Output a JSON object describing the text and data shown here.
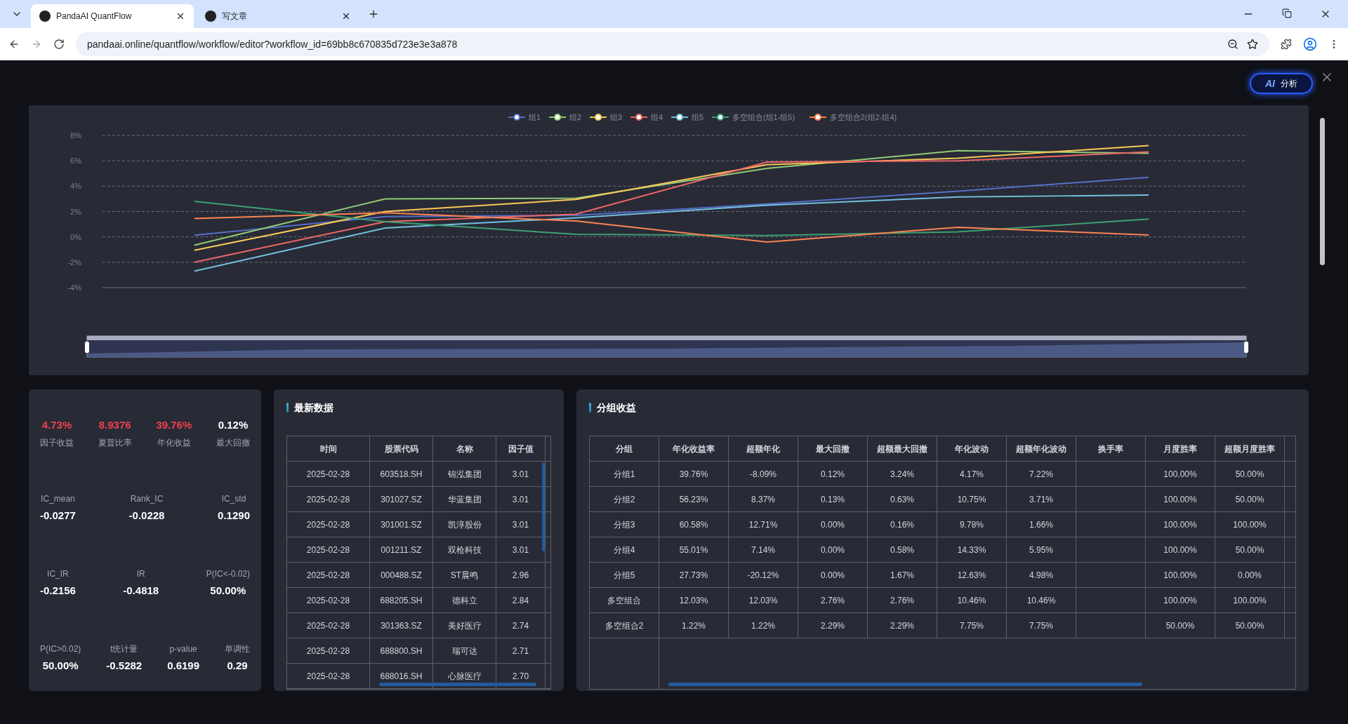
{
  "browser": {
    "tabs": [
      {
        "title": "PandaAI QuantFlow",
        "selected": true
      },
      {
        "title": "写文章",
        "selected": false
      }
    ],
    "url": "pandaai.online/quantflow/workflow/editor?workflow_id=69bb8c670835d723e3e3a878"
  },
  "ai_button": {
    "label": "分析",
    "logo": "AI"
  },
  "chart": {
    "chart_data": {
      "type": "line",
      "legend": "top",
      "grid": true,
      "yticks": [
        {
          "value": 8,
          "label": "8%"
        },
        {
          "value": 6,
          "label": "6%"
        },
        {
          "value": 4,
          "label": "4%"
        },
        {
          "value": 2,
          "label": "2%"
        },
        {
          "value": 0,
          "label": "0%"
        },
        {
          "value": -2,
          "label": "-2%"
        },
        {
          "value": -4,
          "label": "-4%"
        }
      ],
      "ylim": [
        -4,
        8
      ],
      "series": [
        {
          "name": "组1",
          "color": "#5470c6",
          "values": [
            0.13,
            1.6,
            1.7,
            2.6,
            3.6,
            4.7
          ]
        },
        {
          "name": "组2",
          "color": "#91cc75",
          "values": [
            -0.65,
            3.0,
            3.05,
            5.4,
            6.8,
            6.6
          ]
        },
        {
          "name": "组3",
          "color": "#fac858",
          "values": [
            -1.05,
            2.0,
            2.95,
            5.7,
            6.2,
            7.2
          ]
        },
        {
          "name": "组4",
          "color": "#ee6666",
          "values": [
            -2.0,
            1.2,
            1.8,
            5.9,
            6.0,
            6.7
          ]
        },
        {
          "name": "组5",
          "color": "#73c0de",
          "values": [
            -2.7,
            0.7,
            1.5,
            2.5,
            3.15,
            3.3
          ]
        },
        {
          "name": "多空组合(组1-组5)",
          "color": "#3ba272",
          "values": [
            2.8,
            1.2,
            0.2,
            0.1,
            0.4,
            1.4
          ]
        },
        {
          "name": "多空组合2(组2-组4)",
          "color": "#fc8452",
          "values": [
            1.45,
            1.9,
            1.25,
            -0.4,
            0.75,
            0.15
          ]
        }
      ]
    }
  },
  "metrics": {
    "top": [
      {
        "value": "4.73%",
        "label": "因子收益",
        "color": "#f0424f"
      },
      {
        "value": "8.9376",
        "label": "夏普比率",
        "color": "#f0424f"
      },
      {
        "value": "39.76%",
        "label": "年化收益",
        "color": "#f0424f"
      },
      {
        "value": "0.12%",
        "label": "最大回撤",
        "color": "#ffffff"
      }
    ],
    "rows": [
      [
        {
          "label": "IC_mean",
          "value": "-0.0277"
        },
        {
          "label": "Rank_IC",
          "value": "-0.0228"
        },
        {
          "label": "IC_std",
          "value": "0.1290"
        }
      ],
      [
        {
          "label": "IC_IR",
          "value": "-0.2156"
        },
        {
          "label": "IR",
          "value": "-0.4818"
        },
        {
          "label": "P(IC<-0.02)",
          "value": "50.00%"
        }
      ],
      [
        {
          "label": "P(IC>0.02)",
          "value": "50.00%"
        },
        {
          "label": "t统计量",
          "value": "-0.5282"
        },
        {
          "label": "p-value",
          "value": "0.6199"
        },
        {
          "label": "单调性",
          "value": "0.29"
        }
      ]
    ]
  },
  "latest": {
    "title": "最新数据",
    "columns": [
      "时间",
      "股票代码",
      "名称",
      "因子值"
    ],
    "rows": [
      [
        "2025-02-28",
        "603518.SH",
        "锦泓集团",
        "3.01"
      ],
      [
        "2025-02-28",
        "301027.SZ",
        "华蓝集团",
        "3.01"
      ],
      [
        "2025-02-28",
        "301001.SZ",
        "凯淳股份",
        "3.01"
      ],
      [
        "2025-02-28",
        "001211.SZ",
        "双枪科技",
        "3.01"
      ],
      [
        "2025-02-28",
        "000488.SZ",
        "ST晨鸣",
        "2.96"
      ],
      [
        "2025-02-28",
        "688205.SH",
        "德科立",
        "2.84"
      ],
      [
        "2025-02-28",
        "301363.SZ",
        "美好医疗",
        "2.74"
      ],
      [
        "2025-02-28",
        "688800.SH",
        "瑞可达",
        "2.71"
      ],
      [
        "2025-02-28",
        "688016.SH",
        "心脉医疗",
        "2.70"
      ]
    ]
  },
  "groups": {
    "title": "分组收益",
    "columns": [
      "分组",
      "年化收益率",
      "超额年化",
      "最大回撤",
      "超额最大回撤",
      "年化波动",
      "超额年化波动",
      "换手率",
      "月度胜率",
      "超额月度胜率"
    ],
    "rows": [
      [
        "分组1",
        "39.76%",
        "-8.09%",
        "0.12%",
        "3.24%",
        "4.17%",
        "7.22%",
        "",
        "100.00%",
        "50.00%"
      ],
      [
        "分组2",
        "56.23%",
        "8.37%",
        "0.13%",
        "0.63%",
        "10.75%",
        "3.71%",
        "",
        "100.00%",
        "50.00%"
      ],
      [
        "分组3",
        "60.58%",
        "12.71%",
        "0.00%",
        "0.16%",
        "9.78%",
        "1.66%",
        "",
        "100.00%",
        "100.00%"
      ],
      [
        "分组4",
        "55.01%",
        "7.14%",
        "0.00%",
        "0.58%",
        "14.33%",
        "5.95%",
        "",
        "100.00%",
        "50.00%"
      ],
      [
        "分组5",
        "27.73%",
        "-20.12%",
        "0.00%",
        "1.67%",
        "12.63%",
        "4.98%",
        "",
        "100.00%",
        "0.00%"
      ],
      [
        "多空组合",
        "12.03%",
        "12.03%",
        "2.76%",
        "2.76%",
        "10.46%",
        "10.46%",
        "",
        "100.00%",
        "100.00%"
      ],
      [
        "多空组合2",
        "1.22%",
        "1.22%",
        "2.29%",
        "2.29%",
        "7.75%",
        "7.75%",
        "",
        "50.00%",
        "50.00%"
      ]
    ]
  }
}
